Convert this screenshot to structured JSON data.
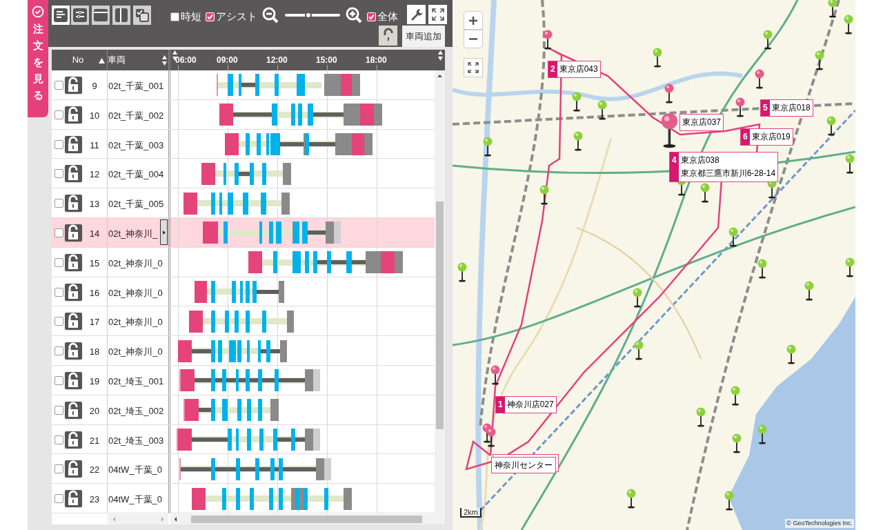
{
  "sidebar_tab": {
    "label": "注文を見る"
  },
  "toolbar": {
    "views": [
      {
        "kind": "list",
        "selected": true
      },
      {
        "kind": "split",
        "selected": false
      },
      {
        "kind": "panel",
        "selected": false
      },
      {
        "kind": "columns",
        "selected": false
      },
      {
        "kind": "copy",
        "selected": false
      }
    ],
    "options": [
      {
        "label": "時短",
        "checked": false
      },
      {
        "label": "アシスト",
        "checked": true
      }
    ],
    "zoom": {
      "level": 0.42
    },
    "all_option": {
      "label": "全体",
      "checked": true
    },
    "lock": {
      "locked": false
    },
    "add_vehicle_button": "車両追加"
  },
  "table": {
    "columns": [
      {
        "label": "No",
        "sorted": true
      },
      {
        "label": "車両",
        "sorted": false
      }
    ],
    "ticks": [
      "06:00",
      "09:00",
      "12:00",
      "15:00",
      "18:00"
    ],
    "rows": [
      {
        "no": "9",
        "vehicle": "02t_千葉_001",
        "checked": false,
        "locked": false,
        "selected": false
      },
      {
        "no": "10",
        "vehicle": "02t_千葉_002",
        "checked": false,
        "locked": false,
        "selected": false
      },
      {
        "no": "11",
        "vehicle": "02t_千葉_003",
        "checked": false,
        "locked": false,
        "selected": false
      },
      {
        "no": "12",
        "vehicle": "02t_千葉_004",
        "checked": false,
        "locked": false,
        "selected": false
      },
      {
        "no": "13",
        "vehicle": "02t_千葉_005",
        "checked": false,
        "locked": false,
        "selected": false
      },
      {
        "no": "14",
        "vehicle": "02t_神奈川_",
        "checked": false,
        "locked": false,
        "selected": true
      },
      {
        "no": "15",
        "vehicle": "02t_神奈川_0",
        "checked": false,
        "locked": false,
        "selected": false
      },
      {
        "no": "16",
        "vehicle": "02t_神奈川_0",
        "checked": false,
        "locked": false,
        "selected": false
      },
      {
        "no": "17",
        "vehicle": "02t_神奈川_0",
        "checked": false,
        "locked": false,
        "selected": false
      },
      {
        "no": "18",
        "vehicle": "02t_神奈川_0",
        "checked": false,
        "locked": false,
        "selected": false
      },
      {
        "no": "19",
        "vehicle": "02t_埼玉_001",
        "checked": false,
        "locked": false,
        "selected": false
      },
      {
        "no": "20",
        "vehicle": "02t_埼玉_002",
        "checked": false,
        "locked": false,
        "selected": false
      },
      {
        "no": "21",
        "vehicle": "02t_埼玉_003",
        "checked": false,
        "locked": false,
        "selected": false
      },
      {
        "no": "22",
        "vehicle": "04tW_千葉_0",
        "checked": false,
        "locked": false,
        "selected": false
      },
      {
        "no": "23",
        "vehicle": "04tW_千葉_0",
        "checked": false,
        "locked": false,
        "selected": false
      }
    ]
  },
  "map": {
    "stops": [
      {
        "number": "1",
        "name": "神奈川店027"
      },
      {
        "number": "2",
        "name": "東京店043"
      },
      {
        "name": "東京店037"
      },
      {
        "number": "4",
        "name": "東京店038",
        "address": "東京都三鷹市新川6-28-14"
      },
      {
        "number": "5",
        "name": "東京店018"
      },
      {
        "number": "6",
        "name": "東京店019"
      }
    ],
    "depot": {
      "name": "神奈川センター"
    },
    "scale": "2km",
    "attribution": "© GeoTechnologies Inc."
  }
}
